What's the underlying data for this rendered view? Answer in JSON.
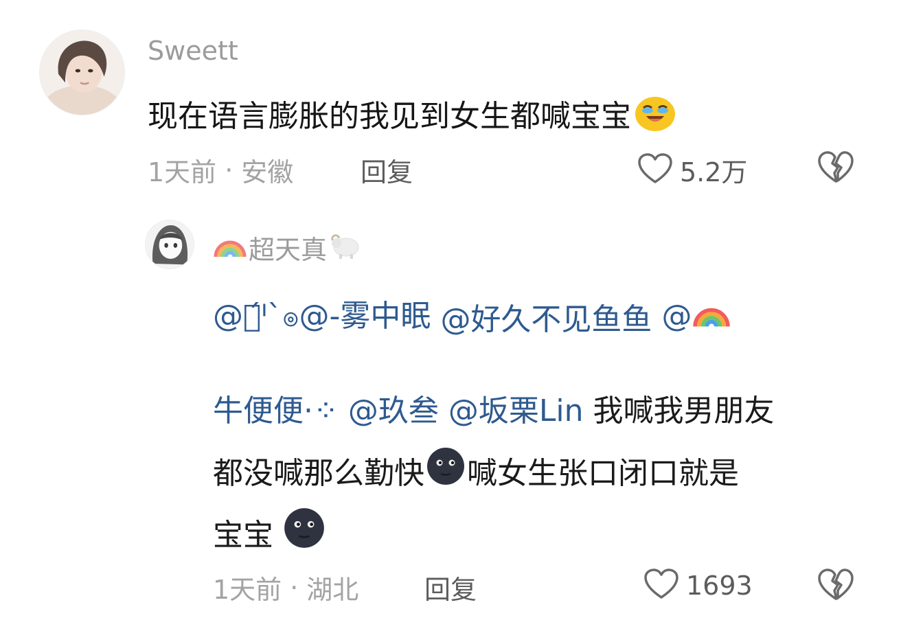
{
  "comments": [
    {
      "username": "Sweett",
      "text": "现在语言膨胀的我见到女生都喊宝宝",
      "time": "1天前",
      "location": "安徽",
      "reply_label": "回复",
      "likes": "5.2万",
      "emoji": "crying-laughing-emoji"
    }
  ],
  "replies": [
    {
      "username": "超天真",
      "mentions_line1": [
        "@ၜ́ᑊ`ၜ@-雾中眠",
        "@好久不见鱼鱼",
        "@"
      ],
      "mentions_line2": [
        "牛便便·⁘",
        "@玖叁",
        "@坂栗Lin"
      ],
      "text_line2": "我喊我男朋友",
      "text_line3a": "都没喊那么勤快",
      "text_line3b": "喊女生张口闭口就是",
      "text_line4": "宝宝",
      "time": "1天前",
      "location": "湖北",
      "reply_label": "回复",
      "likes": "1693"
    }
  ],
  "colors": {
    "mention": "#2e5a8f",
    "meta": "#a3a3a3",
    "username": "#9b9b9b"
  }
}
